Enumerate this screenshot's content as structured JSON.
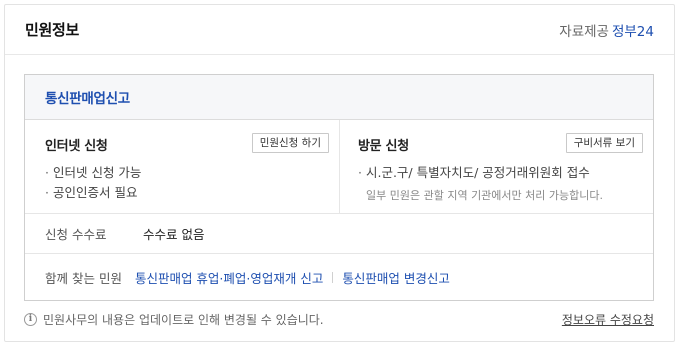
{
  "header": {
    "title": "민원정보",
    "provider_label": "자료제공",
    "provider_link": "정부24"
  },
  "service": {
    "name": "통신판매업신고"
  },
  "online": {
    "title": "인터넷 신청",
    "button_label": "민원신청 하기",
    "items": [
      "인터넷 신청 가능",
      "공인인증서 필요"
    ]
  },
  "visit": {
    "title": "방문 신청",
    "button_label": "구비서류 보기",
    "items": [
      "시.군.구/ 특별자치도/ 공정거래위원회 접수"
    ],
    "note": "일부 민원은 관할 지역 기관에서만 처리 가능합니다."
  },
  "fee": {
    "label": "신청 수수료",
    "value": "수수료 없음"
  },
  "related": {
    "label": "함께 찾는 민원",
    "links": [
      "통신판매업 휴업·폐업·영업재개 신고",
      "통신판매업 변경신고"
    ]
  },
  "footer": {
    "note": "민원사무의 내용은 업데이트로 인해 변경될 수 있습니다.",
    "report_link": "정보오류 수정요청",
    "info_icon": "info-icon"
  },
  "colors": {
    "accent": "#1e4fb0",
    "header_bg": "#f6f7f9",
    "border": "#cfcfcf"
  }
}
